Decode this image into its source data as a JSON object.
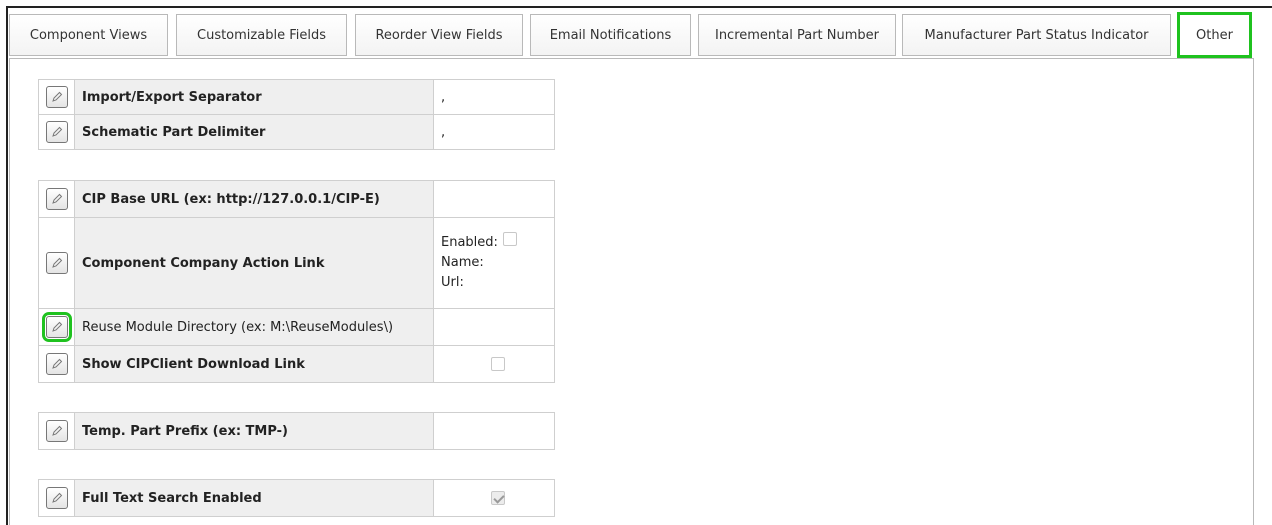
{
  "tabs": [
    {
      "label": "Component Views"
    },
    {
      "label": "Customizable Fields"
    },
    {
      "label": "Reorder View Fields"
    },
    {
      "label": "Email Notifications"
    },
    {
      "label": "Incremental Part Number"
    },
    {
      "label": "Manufacturer Part Status Indicator"
    },
    {
      "label": "Other",
      "active": true
    }
  ],
  "groups": [
    {
      "rows": [
        {
          "label": "Import/Export Separator",
          "value": ","
        },
        {
          "label": "Schematic Part Delimiter",
          "value": ","
        }
      ]
    },
    {
      "rows": [
        {
          "label": "CIP Base URL (ex: http://127.0.0.1/CIP-E)",
          "value": ""
        },
        {
          "label": "Component Company Action Link",
          "enabled_label": "Enabled:",
          "enabled": false,
          "name_label": "Name:",
          "url_label": "Url:"
        },
        {
          "label": "Reuse Module Directory (ex: M:\\ReuseModules\\)",
          "value": ""
        },
        {
          "label": "Show CIPClient Download Link",
          "checked": false
        }
      ]
    },
    {
      "rows": [
        {
          "label": "Temp. Part Prefix (ex: TMP-)",
          "value": ""
        }
      ]
    },
    {
      "rows": [
        {
          "label": "Full Text Search Enabled",
          "checked": true
        }
      ]
    }
  ],
  "icons": {
    "edit": "pencil-icon"
  },
  "colors": {
    "highlight": "#1fc21f",
    "label_bg": "#efefef",
    "border": "#cfcfcf"
  }
}
